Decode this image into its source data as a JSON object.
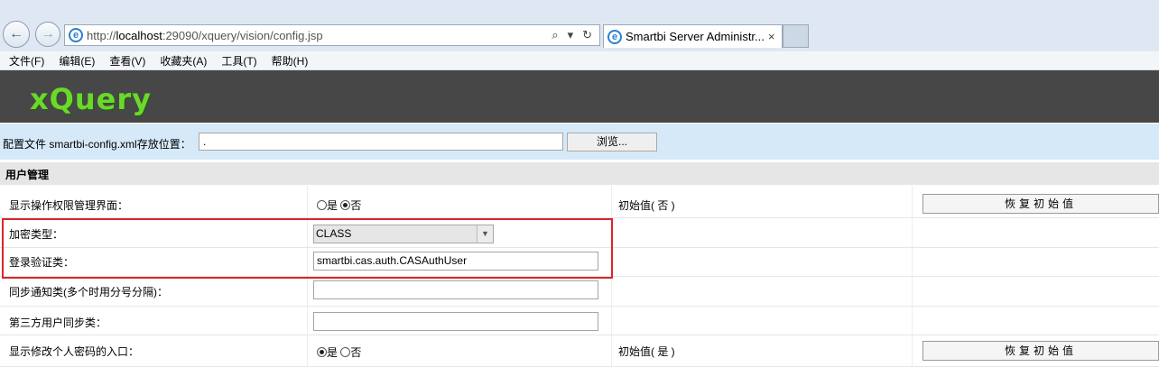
{
  "browser": {
    "url_prefix": "http://",
    "url_host": "localhost",
    "url_rest": ":29090/xquery/vision/config.jsp",
    "tab_title": "Smartbi Server Administr...",
    "tab_close": "×",
    "back_icon": "←",
    "forward_icon": "→",
    "ie_icon": "e",
    "search_icon": "⌕",
    "dropdown_icon": "▾",
    "refresh_icon": "↻"
  },
  "menu": [
    "文件(F)",
    "编辑(E)",
    "查看(V)",
    "收藏夹(A)",
    "工具(T)",
    "帮助(H)"
  ],
  "brand": {
    "logo": "xQuery"
  },
  "config": {
    "label": "配置文件 smartbi-config.xml存放位置：",
    "path_value": ".",
    "browse_label": "浏览..."
  },
  "section": {
    "title": "用户管理"
  },
  "rows": {
    "show_permission_ui": {
      "label": "显示操作权限管理界面：",
      "yes": "是",
      "no": "否",
      "selected": "否",
      "initial": "初始值( 否 )",
      "restore": "恢复初始值"
    },
    "encrypt_type": {
      "label": "加密类型：",
      "value": "CLASS",
      "arrow": "▼"
    },
    "login_class": {
      "label": "登录验证类：",
      "value": "smartbi.cas.auth.CASAuthUser"
    },
    "sync_notify": {
      "label": "同步通知类(多个时用分号分隔)：",
      "value": ""
    },
    "third_party_sync": {
      "label": "第三方用户同步类：",
      "value": ""
    },
    "show_change_password": {
      "label": "显示修改个人密码的入口：",
      "yes": "是",
      "no": "否",
      "selected": "是",
      "initial": "初始值( 是 )",
      "restore": "恢复初始值"
    }
  },
  "colors": {
    "banner": "#474747",
    "logo": "#6bd82c",
    "config_bar": "#d6e9f8",
    "highlight": "#d9252c"
  }
}
